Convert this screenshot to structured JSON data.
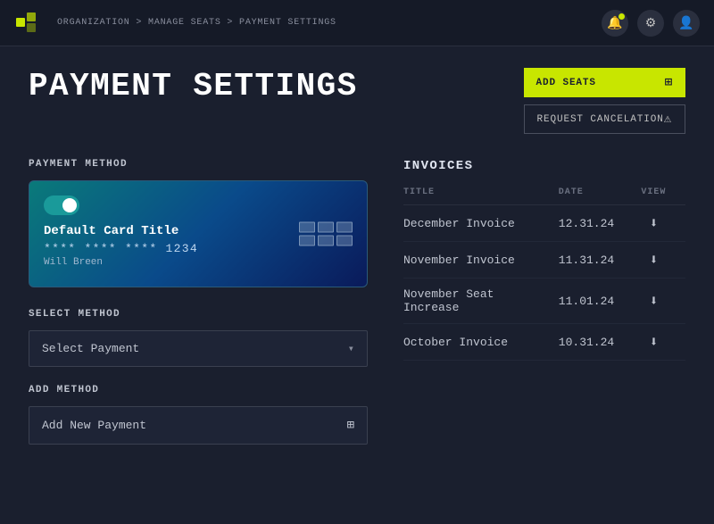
{
  "topbar": {
    "logo_alt": "logo",
    "breadcrumb": "Organization > Manage Seats > Payment Settings",
    "icons": {
      "bell": "🔔",
      "settings": "⚙",
      "user": "👤"
    }
  },
  "page": {
    "title": "Payment Settings"
  },
  "header_actions": {
    "add_seats_label": "Add Seats",
    "request_cancel_label": "Request Cancelation"
  },
  "payment_method": {
    "section_label": "Payment Method",
    "card": {
      "title": "Default Card Title",
      "number": "**** **** **** 1234",
      "name": "Will Breen"
    }
  },
  "select_method": {
    "section_label": "Select Method",
    "dropdown_value": "Select Payment",
    "placeholder": "Select Payment"
  },
  "add_method": {
    "section_label": "Add Method",
    "button_label": "Add New Payment"
  },
  "invoices": {
    "title": "Invoices",
    "columns": {
      "title": "Title",
      "date": "Date",
      "view": "View"
    },
    "rows": [
      {
        "title": "December Invoice",
        "date": "12.31.24"
      },
      {
        "title": "November Invoice",
        "date": "11.31.24"
      },
      {
        "title": "November Seat Increase",
        "date": "11.01.24"
      },
      {
        "title": "October Invoice",
        "date": "10.31.24"
      }
    ]
  },
  "colors": {
    "accent": "#c8e600",
    "dark_bg": "#1a1f2e",
    "card_gradient_start": "#0a7a7a",
    "card_gradient_end": "#0a1a5a"
  }
}
